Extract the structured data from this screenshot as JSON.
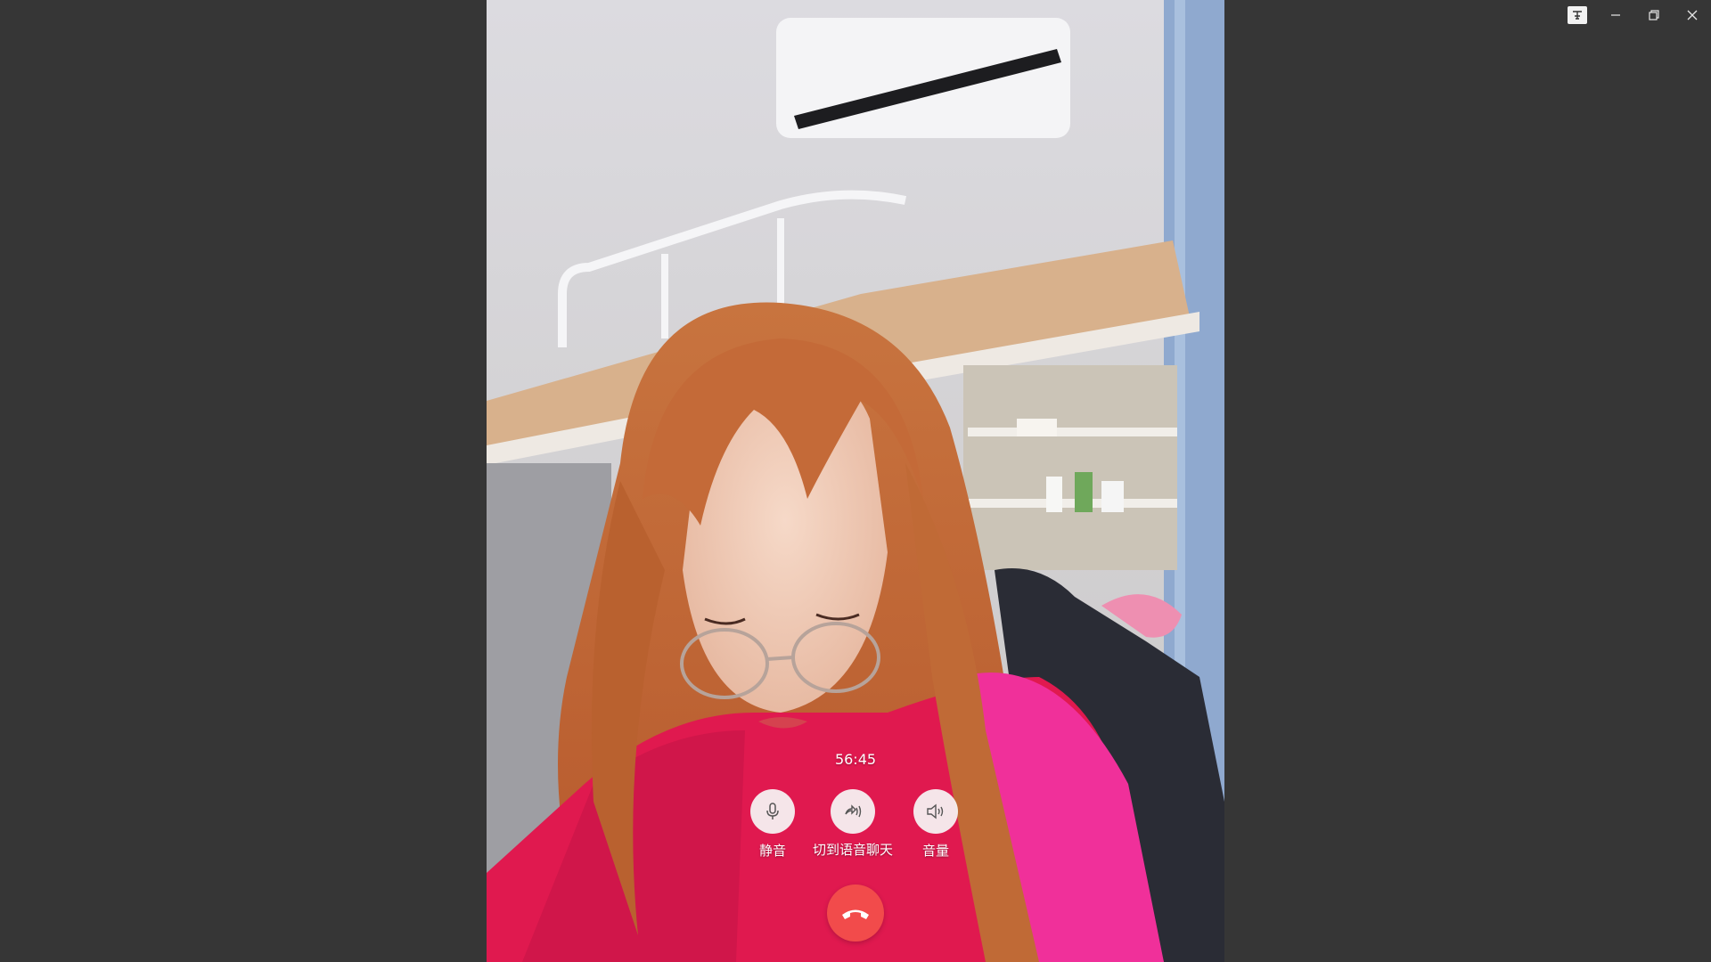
{
  "window": {
    "controls": [
      "pin-icon",
      "minimize-icon",
      "restore-icon",
      "close-icon"
    ]
  },
  "call": {
    "timer": "56:45",
    "controls": [
      {
        "label": "静音",
        "icon": "microphone-icon"
      },
      {
        "label": "切到语音聊天",
        "icon": "voice-switch-icon"
      },
      {
        "label": "音量",
        "icon": "speaker-icon"
      }
    ],
    "hangup_icon": "hang-up-icon"
  },
  "colors": {
    "background": "#363636",
    "hangup": "#f24b4b",
    "control_circle": "#f6f6f6"
  }
}
